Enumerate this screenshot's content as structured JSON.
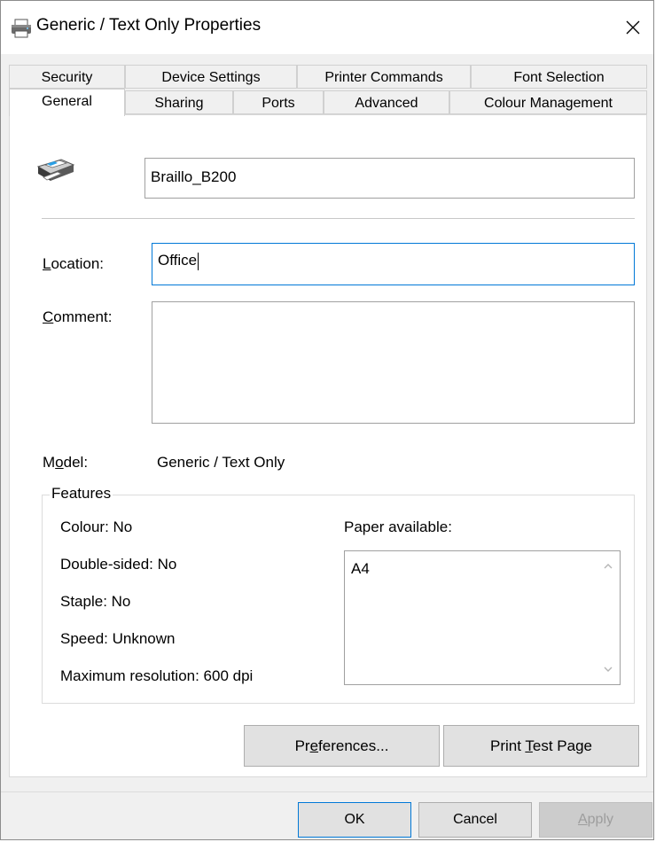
{
  "window": {
    "title": "Generic / Text Only Properties",
    "title_icon": "printer-icon",
    "close_icon": "close-icon"
  },
  "tabs": {
    "row1": [
      {
        "label": "Security"
      },
      {
        "label": "Device Settings"
      },
      {
        "label": "Printer Commands"
      },
      {
        "label": "Font Selection"
      }
    ],
    "row2": [
      {
        "label": "General",
        "active": true
      },
      {
        "label": "Sharing"
      },
      {
        "label": "Ports"
      },
      {
        "label": "Advanced"
      },
      {
        "label": "Colour Management"
      }
    ]
  },
  "general": {
    "printer_name": "Braillo_B200",
    "location_label": {
      "pre": "",
      "u": "L",
      "post": "ocation:"
    },
    "location_value": "Office",
    "comment_label": {
      "pre": "",
      "u": "C",
      "post": "omment:"
    },
    "comment_value": "",
    "model_label": {
      "pre": "M",
      "u": "o",
      "post": "del:"
    },
    "model_value": "Generic / Text Only"
  },
  "features": {
    "title": "Features",
    "items": [
      "Colour: No",
      "Double-sided: No",
      "Staple: No",
      "Speed: Unknown",
      "Maximum resolution: 600 dpi"
    ],
    "paper_label": "Paper available:",
    "paper_items": [
      "A4"
    ]
  },
  "buttons": {
    "preferences": {
      "pre": "Pr",
      "u": "e",
      "post": "ferences..."
    },
    "print_test_page": {
      "pre": "Print ",
      "u": "T",
      "post": "est Page"
    },
    "ok": "OK",
    "cancel": "Cancel",
    "apply": {
      "pre": "",
      "u": "A",
      "post": "pply"
    }
  },
  "colors": {
    "accent": "#0078d7",
    "dialog_bg": "#f0f0f0",
    "disabled_text": "#9d9d9d"
  }
}
